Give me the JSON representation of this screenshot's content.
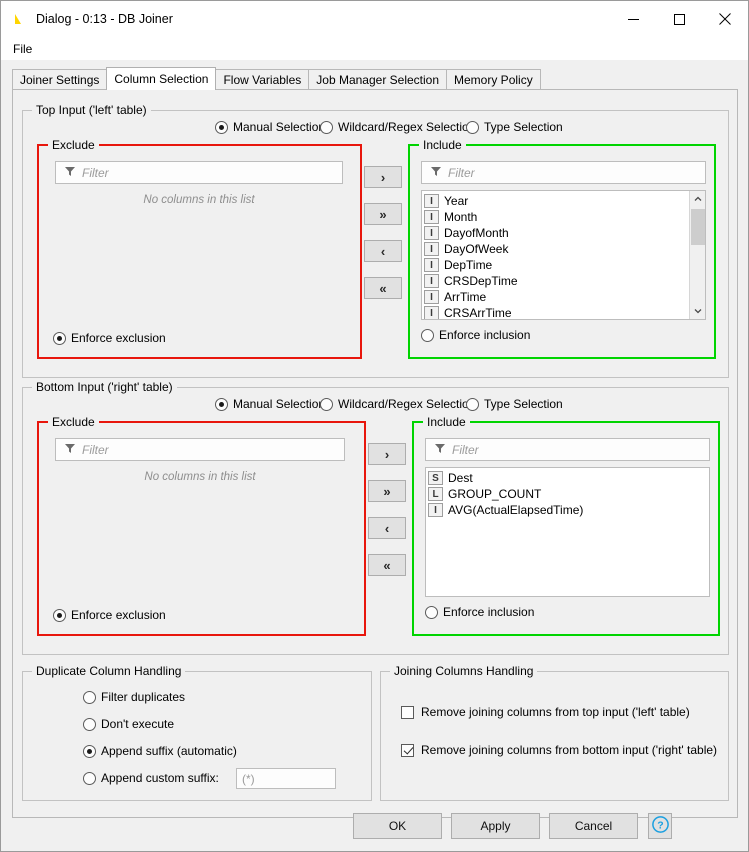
{
  "window": {
    "title": "Dialog - 0:13 - DB Joiner",
    "icon": "knime-triangle-icon",
    "controls": {
      "minimize": "minimize-icon",
      "maximize": "maximize-icon",
      "close": "close-icon"
    }
  },
  "menubar": {
    "items": [
      {
        "label": "File"
      }
    ]
  },
  "tabs": [
    {
      "label": "Joiner Settings",
      "active": false
    },
    {
      "label": "Column Selection",
      "active": true
    },
    {
      "label": "Flow Variables",
      "active": false
    },
    {
      "label": "Job Manager Selection",
      "active": false
    },
    {
      "label": "Memory Policy",
      "active": false
    }
  ],
  "colors": {
    "exclude_border": "#e8160c",
    "include_border": "#00d400",
    "window_bg": "#f0f0f0",
    "help_icon": "#1a9fe0"
  },
  "top_input": {
    "title": "Top Input ('left' table)",
    "modes": [
      {
        "label": "Manual Selection",
        "selected": true
      },
      {
        "label": "Wildcard/Regex Selection",
        "selected": false
      },
      {
        "label": "Type Selection",
        "selected": false
      }
    ],
    "exclude": {
      "title": "Exclude",
      "filter_placeholder": "Filter",
      "empty_text": "No columns in this list",
      "items": [],
      "enforce": {
        "label": "Enforce exclusion",
        "selected": true
      }
    },
    "include": {
      "title": "Include",
      "filter_placeholder": "Filter",
      "items": [
        {
          "type": "I",
          "label": "Year"
        },
        {
          "type": "I",
          "label": "Month"
        },
        {
          "type": "I",
          "label": "DayofMonth"
        },
        {
          "type": "I",
          "label": "DayOfWeek"
        },
        {
          "type": "I",
          "label": "DepTime"
        },
        {
          "type": "I",
          "label": "CRSDepTime"
        },
        {
          "type": "I",
          "label": "ArrTime"
        },
        {
          "type": "I",
          "label": "CRSArrTime"
        }
      ],
      "enforce": {
        "label": "Enforce inclusion",
        "selected": false
      },
      "scrollbar": true
    },
    "transfer_buttons": [
      {
        "label": "›",
        "name": "move-right-button"
      },
      {
        "label": "»",
        "name": "move-all-right-button"
      },
      {
        "label": "‹",
        "name": "move-left-button"
      },
      {
        "label": "«",
        "name": "move-all-left-button"
      }
    ]
  },
  "bottom_input": {
    "title": "Bottom Input ('right' table)",
    "modes": [
      {
        "label": "Manual Selection",
        "selected": true
      },
      {
        "label": "Wildcard/Regex Selection",
        "selected": false
      },
      {
        "label": "Type Selection",
        "selected": false
      }
    ],
    "exclude": {
      "title": "Exclude",
      "filter_placeholder": "Filter",
      "empty_text": "No columns in this list",
      "items": [],
      "enforce": {
        "label": "Enforce exclusion",
        "selected": true
      }
    },
    "include": {
      "title": "Include",
      "filter_placeholder": "Filter",
      "items": [
        {
          "type": "S",
          "label": "Dest"
        },
        {
          "type": "L",
          "label": "GROUP_COUNT"
        },
        {
          "type": "I",
          "label": "AVG(ActualElapsedTime)"
        }
      ],
      "enforce": {
        "label": "Enforce inclusion",
        "selected": false
      },
      "scrollbar": false
    },
    "transfer_buttons": [
      {
        "label": "›",
        "name": "move-right-button"
      },
      {
        "label": "»",
        "name": "move-all-right-button"
      },
      {
        "label": "‹",
        "name": "move-left-button"
      },
      {
        "label": "«",
        "name": "move-all-left-button"
      }
    ]
  },
  "duplicate_handling": {
    "title": "Duplicate Column Handling",
    "options": [
      {
        "label": "Filter duplicates",
        "selected": false
      },
      {
        "label": "Don't execute",
        "selected": false
      },
      {
        "label": "Append suffix (automatic)",
        "selected": true
      },
      {
        "label": "Append custom suffix:",
        "selected": false
      }
    ],
    "custom_suffix": {
      "value": "",
      "placeholder": "(*)"
    }
  },
  "joining_handling": {
    "title": "Joining Columns Handling",
    "options": [
      {
        "label": "Remove joining columns from top input ('left' table)",
        "checked": false
      },
      {
        "label": "Remove joining columns from bottom input ('right' table)",
        "checked": true
      }
    ]
  },
  "footer": {
    "ok": "OK",
    "apply": "Apply",
    "cancel": "Cancel",
    "help": "help-icon"
  }
}
